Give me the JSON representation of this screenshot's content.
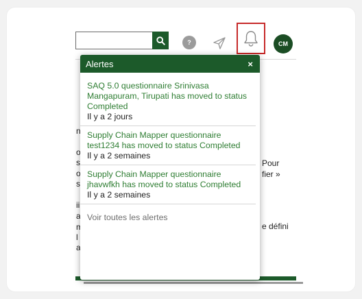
{
  "header": {
    "search": {
      "value": "",
      "placeholder": ""
    },
    "help_label": "?",
    "avatar_initials": "CM"
  },
  "background_text": {
    "left_fragments": [
      "ns",
      "o",
      "s",
      "oi",
      "s",
      "ii",
      "a",
      "m",
      "l",
      "a"
    ],
    "right_fragments": [
      "Pour",
      "fier »",
      "e défini"
    ]
  },
  "alerts": {
    "title": "Alertes",
    "close_label": "×",
    "items": [
      {
        "message": "SAQ 5.0 questionnaire Srinivasa Mangapuram, Tirupati has moved to status Completed",
        "time": "Il y a 2 jours"
      },
      {
        "message": "Supply Chain Mapper questionnaire test1234 has moved to status Completed",
        "time": "Il y a 2 semaines"
      },
      {
        "message": "Supply Chain Mapper questionnaire jhavwfkh has moved to status Completed",
        "time": "Il y a 2 semaines"
      }
    ],
    "view_all_label": "Voir toutes les alertes"
  },
  "colors": {
    "brand_green": "#1c5a2a",
    "alert_text_green": "#2e7d32",
    "highlight_red": "#c62828"
  },
  "icons": [
    "search-icon",
    "help-icon",
    "send-icon",
    "bell-icon",
    "close-icon"
  ]
}
